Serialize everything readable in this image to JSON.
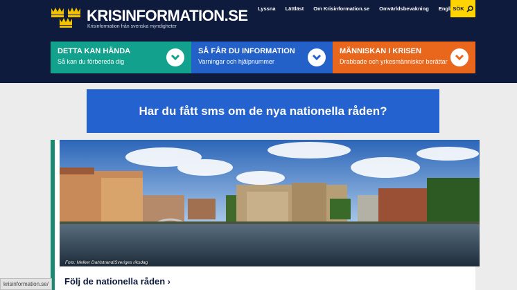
{
  "brand": {
    "name": "KRISINFORMATION.SE",
    "tagline": "Krisinformation från svenska myndigheter"
  },
  "topnav": [
    {
      "label": "Lyssna"
    },
    {
      "label": "Lättläst"
    },
    {
      "label": "Om Krisinformation.se"
    },
    {
      "label": "Omvärldsbevakning"
    },
    {
      "label": "English"
    }
  ],
  "search": {
    "label": "SÖK",
    "icon": "search-icon"
  },
  "tiles": [
    {
      "title": "DETTA KAN HÄNDA",
      "subtitle": "Så kan du förbereda dig",
      "color": "#12a18c"
    },
    {
      "title": "SÅ FÅR DU INFORMATION",
      "subtitle": "Varningar och hjälpnummer",
      "color": "#2360c8"
    },
    {
      "title": "MÄNNISKAN I KRISEN",
      "subtitle": "Drabbade och yrkesmänniskor berättar",
      "color": "#e8671c"
    }
  ],
  "banner": {
    "text": "Har du fått sms om de nya nationella råden?"
  },
  "article": {
    "credit": "Foto: Melker Dahlstrand/Sveriges riksdag",
    "headline": "Följ de nationella råden",
    "arrow": "›"
  },
  "statusbar": {
    "url": "krisinformation.se/"
  }
}
